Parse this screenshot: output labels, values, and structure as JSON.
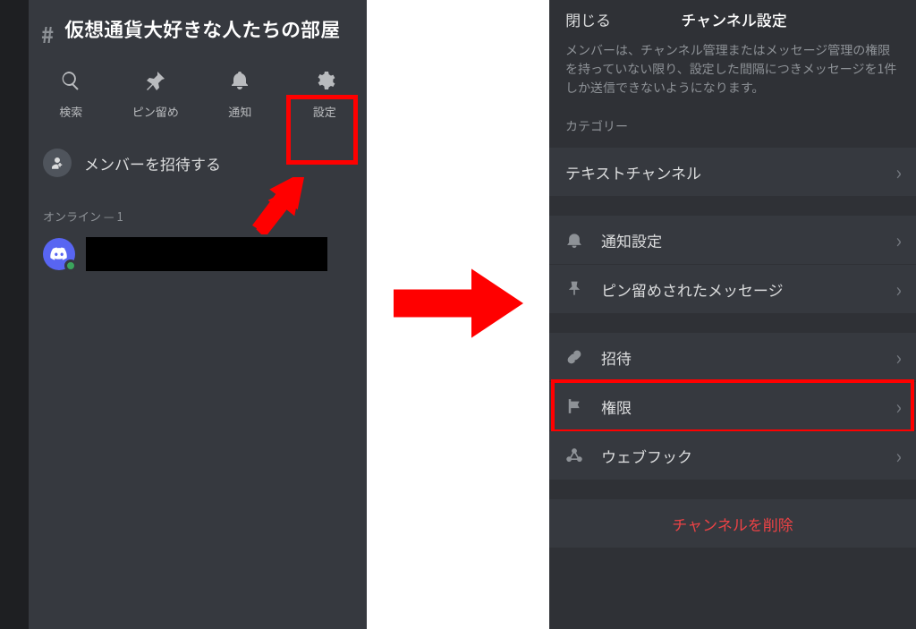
{
  "left": {
    "channel_name": "仮想通貨大好きな人たちの部屋",
    "actions": {
      "search": "検索",
      "pins": "ピン留め",
      "notify": "通知",
      "settings": "設定"
    },
    "invite_label": "メンバーを招待する",
    "online_label": "オンライン — 1"
  },
  "right": {
    "close_label": "閉じる",
    "title": "チャンネル設定",
    "description": "メンバーは、チャンネル管理またはメッセージ管理の権限を持っていない限り、設定した間隔につきメッセージを1件しか送信できないようになります。",
    "category_label": "カテゴリー",
    "items": {
      "text_channel": "テキストチャンネル",
      "notify_settings": "通知設定",
      "pinned_messages": "ピン留めされたメッセージ",
      "invite": "招待",
      "permissions": "権限",
      "webhook": "ウェブフック"
    },
    "delete_label": "チャンネルを削除"
  }
}
